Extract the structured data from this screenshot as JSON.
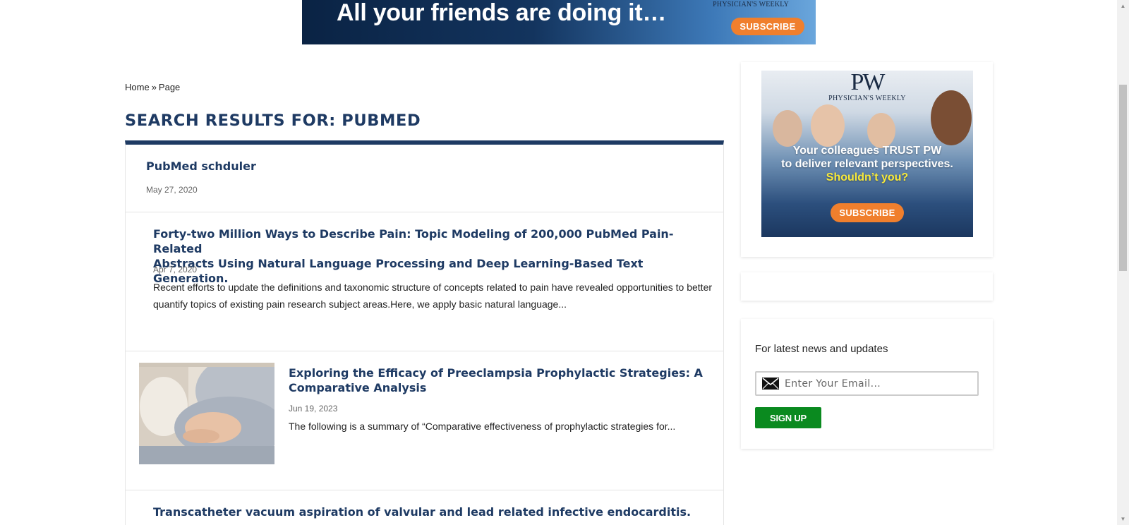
{
  "top_ad": {
    "headline": "All your friends are doing it…",
    "brand": "PHYSICIAN'S WEEKLY",
    "subscribe_label": "SUBSCRIBE"
  },
  "breadcrumb": {
    "home": "Home",
    "separator": "»",
    "current": "Page"
  },
  "page_title": "SEARCH RESULTS FOR: PUBMED",
  "results": [
    {
      "title": "PubMed schduler",
      "date": "May 27, 2020",
      "excerpt": ""
    },
    {
      "title_line1": "Forty-two Million Ways to Describe Pain: Topic Modeling of 200,000 PubMed Pain-Related",
      "title_line2": "Abstracts Using Natural Language Processing and Deep Learning-Based Text Generation.",
      "date": "Apr 7, 2020",
      "excerpt_line1": "Recent efforts to update the definitions and taxonomic structure of concepts related to pain have revealed opportunities to better",
      "excerpt_line2": "quantify topics of existing pain research subject areas.Here, we apply basic natural language..."
    },
    {
      "title_line1": "Exploring the Efficacy of Preeclampsia Prophylactic Strategies: A",
      "title_line2": "Comparative Analysis",
      "date": "Jun 19, 2023",
      "excerpt": "The following is a summary of “Comparative effectiveness of prophylactic strategies for..."
    },
    {
      "title": "Transcatheter vacuum aspiration of valvular and lead related infective endocarditis."
    }
  ],
  "sidebar": {
    "ad": {
      "logo": "PW",
      "brand": "PHYSICIAN'S WEEKLY",
      "line1": "Your colleagues TRUST PW",
      "line2": "to deliver relevant perspectives.",
      "line3": "Shouldn’t you?",
      "subscribe_label": "SUBSCRIBE"
    },
    "newsletter": {
      "label": "For latest news and updates",
      "email_placeholder": "Enter Your Email...",
      "signup_label": "SIGN UP"
    }
  },
  "colors": {
    "title_navy": "#1e3a63",
    "signup_green": "#0a8a1f",
    "ad_orange": "#f07f2d"
  }
}
